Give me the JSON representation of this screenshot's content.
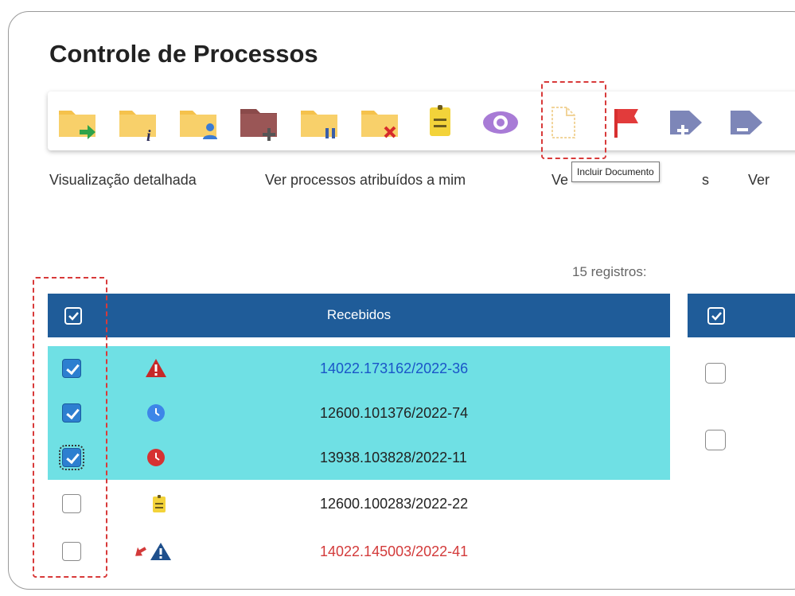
{
  "page": {
    "title": "Controle de Processos"
  },
  "toolbar": {
    "items": [
      {
        "icon": "folder-send-icon"
      },
      {
        "icon": "folder-info-icon"
      },
      {
        "icon": "folder-user-icon"
      },
      {
        "icon": "folder-add-icon"
      },
      {
        "icon": "folder-pause-icon"
      },
      {
        "icon": "folder-close-icon"
      },
      {
        "icon": "note-icon"
      },
      {
        "icon": "eye-icon"
      },
      {
        "icon": "document-add-icon"
      },
      {
        "icon": "flag-icon"
      },
      {
        "icon": "tag-add-icon"
      },
      {
        "icon": "tag-remove-icon"
      }
    ],
    "tooltip": "Incluir Documento"
  },
  "links": {
    "detailed_view": "Visualização detalhada",
    "assigned_to_me": "Ver processos atribuídos a mim",
    "third_prefix": "Ve",
    "third_suffix": "s",
    "fourth": "Ver"
  },
  "table": {
    "count_label": "15 registros:",
    "header": "Recebidos",
    "rows": [
      {
        "number": "14022.173162/2022-36",
        "selected": true,
        "status_icon": "warning-icon",
        "color": "#1a55c8"
      },
      {
        "number": "12600.101376/2022-74",
        "selected": true,
        "status_icon": "clock-blue-icon",
        "color": "#222222"
      },
      {
        "number": "13938.103828/2022-11",
        "selected": true,
        "status_icon": "clock-red-icon",
        "color": "#222222"
      },
      {
        "number": "12600.100283/2022-22",
        "selected": false,
        "status_icon": "note-icon",
        "color": "#222222"
      },
      {
        "number": "14022.145003/2022-41",
        "selected": false,
        "status_icon": "transfer-alert-icon",
        "color": "#d33a3a"
      }
    ]
  },
  "colors": {
    "header_bg": "#1f5c99",
    "selected_row": "#6fe0e4",
    "highlight": "#d83a3a"
  }
}
